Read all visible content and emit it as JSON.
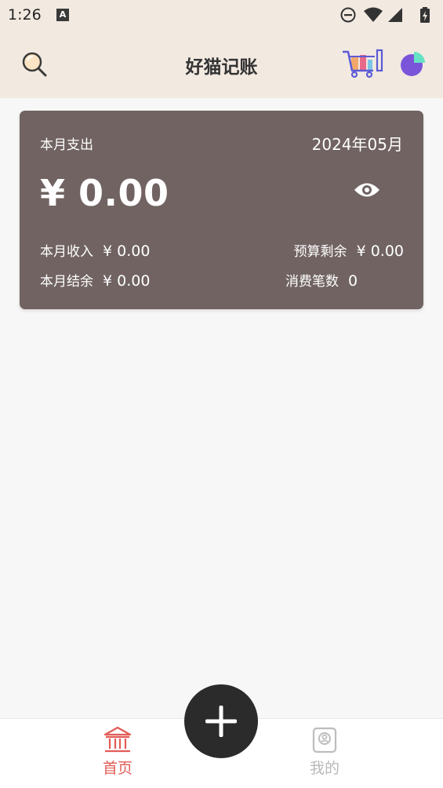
{
  "status_bar": {
    "time": "1:26",
    "notification_icon": "A"
  },
  "header": {
    "title": "好猫记账",
    "icons": [
      "search-icon",
      "shopping-cart-icon",
      "pie-chart-icon"
    ]
  },
  "summary": {
    "expense_label": "本月支出",
    "month": "2024年05月",
    "expense_amount": "¥ 0.00",
    "income_label": "本月收入",
    "income_value": "¥ 0.00",
    "budget_label": "预算剩余",
    "budget_value": "¥ 0.00",
    "balance_label": "本月结余",
    "balance_value": "¥ 0.00",
    "count_label": "消费笔数",
    "count_value": "0"
  },
  "nav": {
    "home_label": "首页",
    "mine_label": "我的",
    "active_color": "#e25b56",
    "inactive_color": "#b8b8b8"
  },
  "colors": {
    "header_bg": "#f2e9e1",
    "card_bg": "#706362",
    "fab_bg": "#2b2b2b"
  }
}
